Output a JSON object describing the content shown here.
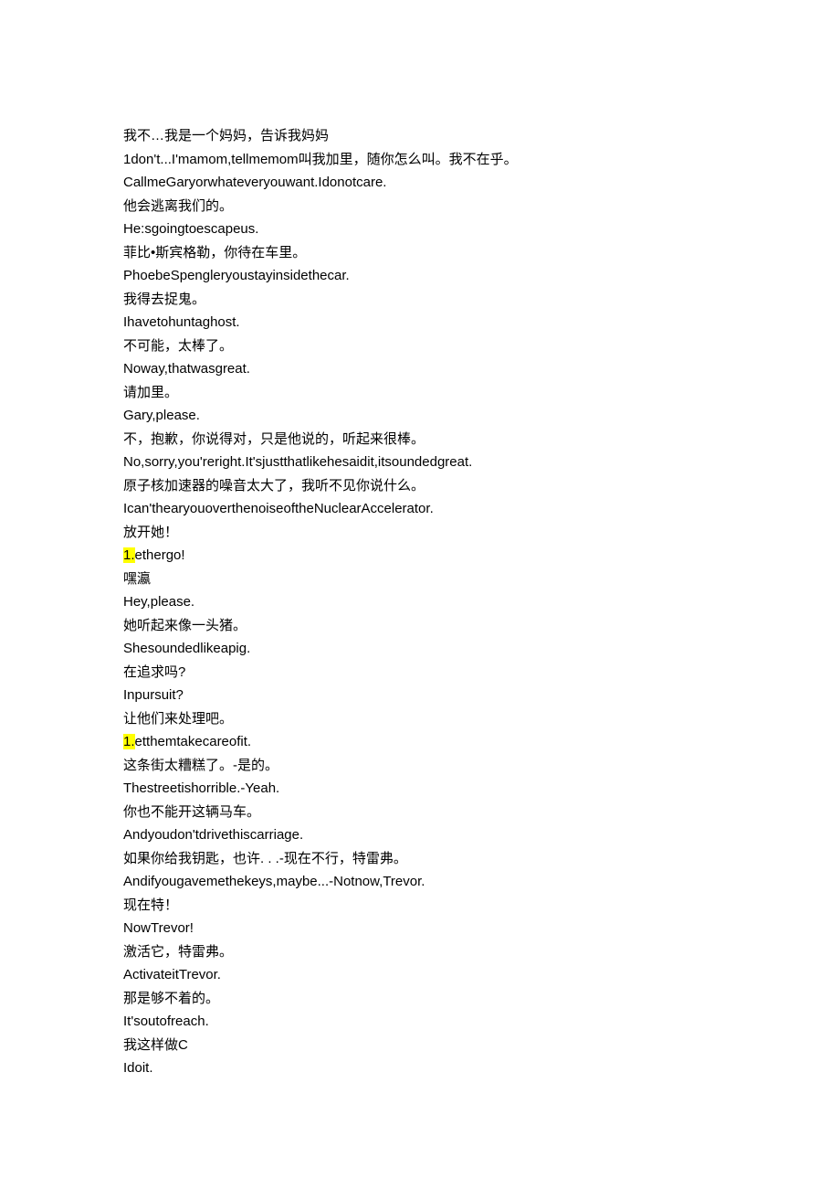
{
  "lines": [
    {
      "text": "我不…我是一个妈妈，告诉我妈妈"
    },
    {
      "text": "1don't...I'mamom,tellmemom叫我加里，随你怎么叫。我不在乎。"
    },
    {
      "text": "CallmeGaryorwhateveryouwant.Idonotcare."
    },
    {
      "text": "他会逃离我们的。"
    },
    {
      "text": "He:sgoingtoescapeus."
    },
    {
      "text": "菲比•斯宾格勒，你待在车里。"
    },
    {
      "text": "PhoebeSpengleryoustayinsidethecar."
    },
    {
      "text": "我得去捉鬼。"
    },
    {
      "text": "Ihavetohuntaghost."
    },
    {
      "text": "不可能，太棒了。"
    },
    {
      "text": "Noway,thatwasgreat."
    },
    {
      "text": "请加里。"
    },
    {
      "text": "Gary,please."
    },
    {
      "text": "不，抱歉，你说得对，只是他说的，听起来很棒。"
    },
    {
      "text": "No,sorry,you'reright.It'sjustthatlikehesaidit,itsoundedgreat."
    },
    {
      "text": "原子核加速器的噪音太大了，我听不见你说什么。"
    },
    {
      "text": "Ican'thearyouoverthenoiseoftheNuclearAccelerator."
    },
    {
      "text": "放开她！"
    },
    {
      "hl": "1.",
      "rest": "ethergo!"
    },
    {
      "text": "嘿瀛"
    },
    {
      "text": "Hey,please."
    },
    {
      "text": "她听起来像一头猪。"
    },
    {
      "text": "Shesoundedlikeapig."
    },
    {
      "text": "在追求吗?"
    },
    {
      "text": "Inpursuit?"
    },
    {
      "text": "让他们来处理吧。"
    },
    {
      "hl": "1.",
      "rest": "etthemtakecareofit."
    },
    {
      "text": "这条街太糟糕了。-是的。"
    },
    {
      "text": "Thestreetishorrible.-Yeah."
    },
    {
      "text": "你也不能开这辆马车。"
    },
    {
      "text": "Andyoudon'tdrivethiscarriage."
    },
    {
      "text": "如果你给我钥匙，也许. . .-现在不行，特雷弗。"
    },
    {
      "text": "Andifyougavemethekeys,maybe...-Notnow,Trevor."
    },
    {
      "text": "现在特！"
    },
    {
      "text": "NowTrevor!"
    },
    {
      "text": "激活它，特雷弗。"
    },
    {
      "text": "ActivateitTrevor."
    },
    {
      "text": "那是够不着的。"
    },
    {
      "text": "It'soutofreach."
    },
    {
      "text": "我这样做C"
    },
    {
      "text": "Idoit."
    }
  ]
}
